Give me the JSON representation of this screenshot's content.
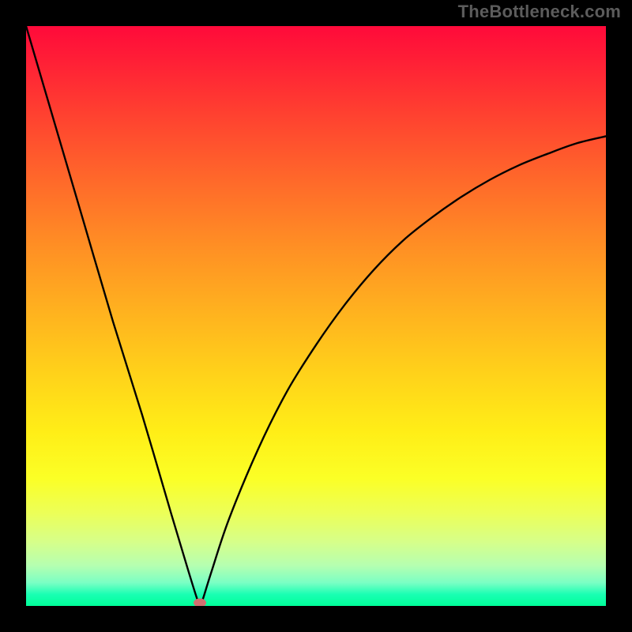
{
  "watermark": "TheBottleneck.com",
  "colors": {
    "frame": "#000000",
    "marker": "#cf6f70",
    "curve": "#000000"
  },
  "chart_data": {
    "type": "line",
    "title": "",
    "xlabel": "",
    "ylabel": "",
    "xlim": [
      0,
      100
    ],
    "ylim": [
      0,
      100
    ],
    "grid": false,
    "series": [
      {
        "name": "bottleneck-curve",
        "x": [
          0,
          5,
          10,
          15,
          20,
          25,
          28,
          29.5,
          30,
          30.5,
          32,
          35,
          40,
          45,
          50,
          55,
          60,
          65,
          70,
          75,
          80,
          85,
          90,
          95,
          100
        ],
        "y": [
          100,
          83,
          66,
          49,
          33,
          16,
          6,
          1.2,
          0,
          1.2,
          6,
          15,
          27,
          37,
          45,
          52,
          58,
          63,
          67,
          70.5,
          73.5,
          76,
          78,
          79.8,
          81
        ]
      }
    ],
    "marker": {
      "x": 30,
      "y": 0
    },
    "gradient_stops": [
      {
        "pct": 0,
        "color": "#ff0a3a"
      },
      {
        "pct": 15,
        "color": "#ff4030"
      },
      {
        "pct": 38,
        "color": "#ff8f24"
      },
      {
        "pct": 60,
        "color": "#ffd21a"
      },
      {
        "pct": 78,
        "color": "#fbff26"
      },
      {
        "pct": 93,
        "color": "#b6ffb0"
      },
      {
        "pct": 100,
        "color": "#00ff99"
      }
    ]
  }
}
